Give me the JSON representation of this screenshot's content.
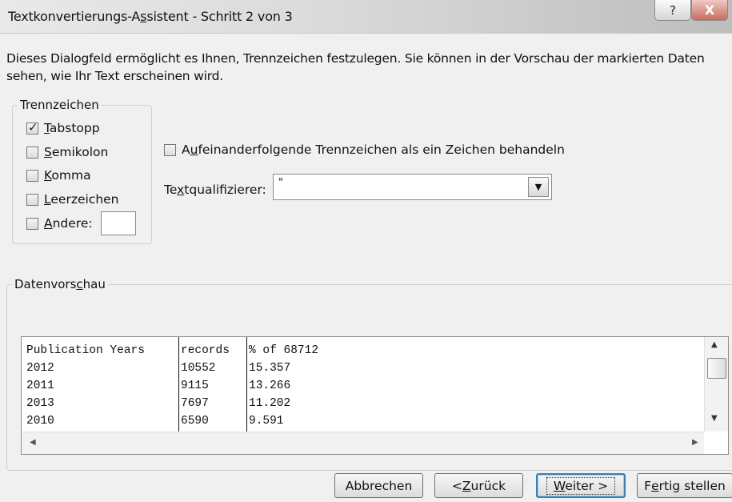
{
  "window": {
    "title_pre": "Textkonvertierungs-A",
    "title_u": "s",
    "title_post": "sistent - Schritt 2 von 3",
    "help_label": "?",
    "close_label": "X"
  },
  "description": "Dieses Dialogfeld ermöglicht es Ihnen, Trennzeichen festzulegen. Sie können in der Vorschau der markierten Daten sehen, wie Ihr Text erscheinen wird.",
  "delimiters": {
    "legend": "Trennzeichen",
    "items": [
      {
        "u": "T",
        "rest": "abstopp",
        "checked": true
      },
      {
        "u": "S",
        "rest": "emikolon",
        "checked": false
      },
      {
        "u": "K",
        "rest": "omma",
        "checked": false
      },
      {
        "u": "L",
        "rest": "eerzeichen",
        "checked": false
      },
      {
        "u": "A",
        "rest": "ndere:",
        "checked": false
      }
    ],
    "other_value": ""
  },
  "consecutive": {
    "pre": "A",
    "u": "u",
    "post": "feinanderfolgende Trennzeichen als ein Zeichen behandeln",
    "checked": false
  },
  "qualifier": {
    "pre": "Te",
    "u": "x",
    "post": "tqualifizierer:",
    "value": "\""
  },
  "preview": {
    "legend_pre": "Datenvors",
    "legend_u": "c",
    "legend_post": "hau",
    "columns": [
      [
        "Publication Years",
        "2012",
        "2011",
        "2013",
        "2010"
      ],
      [
        "records",
        "10552",
        "9115",
        "7697",
        "6590"
      ],
      [
        "% of 68712",
        "15.357",
        "13.266",
        "11.202",
        "9.591"
      ]
    ]
  },
  "buttons": {
    "cancel": "Abbrechen",
    "back_pre": "< ",
    "back_u": "Z",
    "back_post": "urück",
    "next_u": "W",
    "next_post": "eiter >",
    "finish_pre": "F",
    "finish_u": "e",
    "finish_post": "rtig stellen"
  }
}
